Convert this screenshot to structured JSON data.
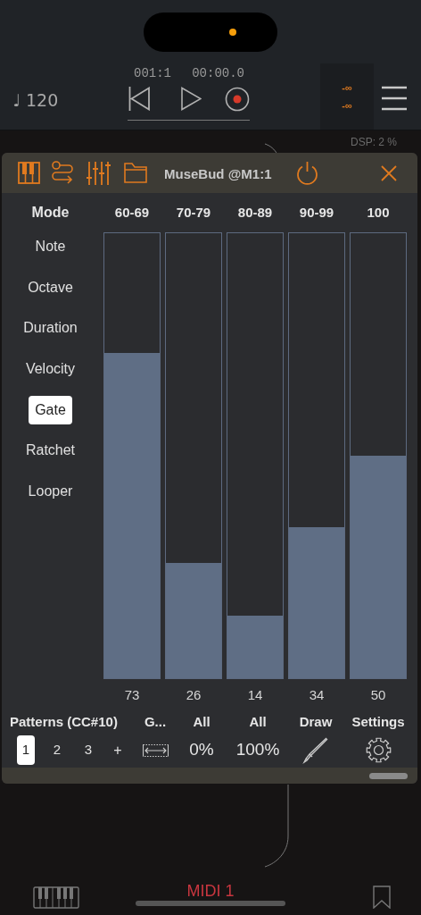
{
  "transport": {
    "position": "001:1",
    "time": "00:00.0",
    "tempo": "♩ 120",
    "meters": [
      "-∞",
      "-∞"
    ],
    "dsp": "DSP: 2 %"
  },
  "plugin": {
    "title": "MuseBud @M1:1",
    "mode_header": "Mode",
    "modes": [
      {
        "label": "Note",
        "selected": false
      },
      {
        "label": "Octave",
        "selected": false
      },
      {
        "label": "Duration",
        "selected": false
      },
      {
        "label": "Velocity",
        "selected": false
      },
      {
        "label": "Gate",
        "selected": true
      },
      {
        "label": "Ratchet",
        "selected": false
      },
      {
        "label": "Looper",
        "selected": false
      }
    ],
    "columns": [
      {
        "header": "60-69",
        "level": 0.73,
        "value": "73"
      },
      {
        "header": "70-79",
        "level": 0.26,
        "value": "26"
      },
      {
        "header": "80-89",
        "level": 0.14,
        "value": "14"
      },
      {
        "header": "90-99",
        "level": 0.34,
        "value": "34"
      },
      {
        "header": "100",
        "level": 0.5,
        "value": "50"
      }
    ],
    "patterns": {
      "label": "Patterns (CC#10)",
      "items": [
        {
          "label": "1",
          "selected": true
        },
        {
          "label": "2",
          "selected": false
        },
        {
          "label": "3",
          "selected": false
        }
      ],
      "add": "+"
    },
    "tools": [
      {
        "label": "G...",
        "kind": "icon"
      },
      {
        "label": "All",
        "kind": "text",
        "text": "0%"
      },
      {
        "label": "All",
        "kind": "text",
        "text": "100%"
      },
      {
        "label": "Draw",
        "kind": "icon"
      },
      {
        "label": "Settings",
        "kind": "icon"
      }
    ]
  },
  "track": {
    "label": "MIDI 1"
  }
}
